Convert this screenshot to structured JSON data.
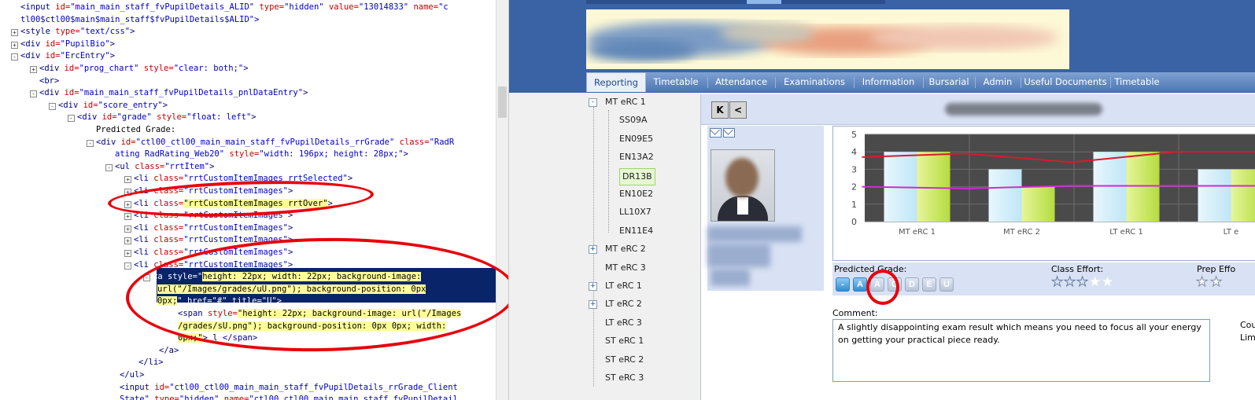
{
  "inspector": {
    "lines": [
      {
        "ind": 26,
        "exp": "",
        "parts": [
          [
            "tg",
            "<input "
          ],
          [
            "at",
            "id="
          ],
          [
            "av",
            "\"main_main_staff_fvPupilDetails_ALID\" "
          ],
          [
            "at",
            "type="
          ],
          [
            "av",
            "\"hidden\" "
          ],
          [
            "at",
            "value="
          ],
          [
            "av",
            "\"13014833\" "
          ],
          [
            "at",
            "name="
          ],
          [
            "av",
            "\"c"
          ]
        ]
      },
      {
        "ind": 26,
        "exp": "",
        "parts": [
          [
            "av",
            "tl00$ctl00$main$main_staff$fvPupilDetails$ALID\""
          ],
          [
            "tg",
            ">"
          ]
        ]
      },
      {
        "ind": 26,
        "exp": "+",
        "parts": [
          [
            "tg",
            "<style "
          ],
          [
            "at",
            "type="
          ],
          [
            "av",
            "\"text/css\""
          ],
          [
            "tg",
            ">"
          ]
        ]
      },
      {
        "ind": 26,
        "exp": "+",
        "parts": [
          [
            "tg",
            "<div "
          ],
          [
            "at",
            "id="
          ],
          [
            "av",
            "\"PupilBio\""
          ],
          [
            "tg",
            ">"
          ]
        ]
      },
      {
        "ind": 26,
        "exp": "-",
        "parts": [
          [
            "tg",
            "<div "
          ],
          [
            "at",
            "id="
          ],
          [
            "av",
            "\"ErcEntry\""
          ],
          [
            "tg",
            ">"
          ]
        ]
      },
      {
        "ind": 50,
        "exp": "+",
        "parts": [
          [
            "tg",
            "<div "
          ],
          [
            "at",
            "id="
          ],
          [
            "av",
            "\"prog_chart\" "
          ],
          [
            "at",
            "style="
          ],
          [
            "av",
            "\"clear: both;\""
          ],
          [
            "tg",
            ">"
          ]
        ]
      },
      {
        "ind": 50,
        "exp": "",
        "parts": [
          [
            "tg",
            "<br>"
          ]
        ]
      },
      {
        "ind": 50,
        "exp": "-",
        "parts": [
          [
            "tg",
            "<div "
          ],
          [
            "at",
            "id="
          ],
          [
            "av",
            "\"main_main_staff_fvPupilDetails_pnlDataEntry\""
          ],
          [
            "tg",
            ">"
          ]
        ]
      },
      {
        "ind": 74,
        "exp": "-",
        "parts": [
          [
            "tg",
            "<div "
          ],
          [
            "at",
            "id="
          ],
          [
            "av",
            "\"score_entry\""
          ],
          [
            "tg",
            ">"
          ]
        ]
      },
      {
        "ind": 98,
        "exp": "-",
        "parts": [
          [
            "tg",
            "<div "
          ],
          [
            "at",
            "id="
          ],
          [
            "av",
            "\"grade\" "
          ],
          [
            "at",
            "style="
          ],
          [
            "av",
            "\"float: left\""
          ],
          [
            "tg",
            ">"
          ]
        ]
      },
      {
        "ind": 122,
        "exp": "",
        "parts": [
          [
            "tx",
            "Predicted Grade:"
          ]
        ]
      },
      {
        "ind": 122,
        "exp": "-",
        "parts": [
          [
            "tg",
            "<div "
          ],
          [
            "at",
            "id="
          ],
          [
            "av",
            "\"ctl00_ctl00_main_main_staff_fvPupilDetails_rrGrade\" "
          ],
          [
            "at",
            "class="
          ],
          [
            "av",
            "\"RadR"
          ]
        ]
      },
      {
        "ind": 146,
        "exp": "",
        "parts": [
          [
            "av",
            "ating RadRating_Web20\" "
          ],
          [
            "at",
            "style="
          ],
          [
            "av",
            "\"width: 196px; height: 28px;\""
          ],
          [
            "tg",
            ">"
          ]
        ]
      },
      {
        "ind": 146,
        "exp": "-",
        "parts": [
          [
            "tg",
            "<ul "
          ],
          [
            "at",
            "class="
          ],
          [
            "av",
            "\"rrtItem\""
          ],
          [
            "tg",
            ">"
          ]
        ]
      },
      {
        "ind": 170,
        "exp": "+",
        "parts": [
          [
            "tg",
            "<li "
          ],
          [
            "at",
            "class="
          ],
          [
            "av",
            "\"rrtCustomItemImages_rrtSelected\""
          ],
          [
            "tg",
            ">"
          ]
        ]
      },
      {
        "ind": 170,
        "exp": "+",
        "parts": [
          [
            "tg",
            "<li "
          ],
          [
            "at",
            "class="
          ],
          [
            "av",
            "\"rrtCustomItemImages\""
          ],
          [
            "tg",
            ">"
          ]
        ]
      },
      {
        "ind": 170,
        "exp": "+",
        "parts": [
          [
            "tg",
            "<li "
          ],
          [
            "at",
            "class="
          ],
          [
            "yl",
            "\"rrtCustomItemImages rrtOver\""
          ],
          [
            "tg",
            ">"
          ]
        ]
      },
      {
        "ind": 170,
        "exp": "+",
        "parts": [
          [
            "tg",
            "<li "
          ],
          [
            "at",
            "class="
          ],
          [
            "av",
            "\"rrtCustomItemImages\""
          ],
          [
            "tg",
            ">"
          ]
        ]
      },
      {
        "ind": 170,
        "exp": "+",
        "parts": [
          [
            "tg",
            "<li "
          ],
          [
            "at",
            "class="
          ],
          [
            "av",
            "\"rrtCustomItemImages\""
          ],
          [
            "tg",
            ">"
          ]
        ]
      },
      {
        "ind": 170,
        "exp": "+",
        "parts": [
          [
            "tg",
            "<li "
          ],
          [
            "at",
            "class="
          ],
          [
            "av",
            "\"rrtCustomItemImages\""
          ],
          [
            "tg",
            ">"
          ]
        ]
      },
      {
        "ind": 170,
        "exp": "+",
        "parts": [
          [
            "tg",
            "<li "
          ],
          [
            "at",
            "class="
          ],
          [
            "av",
            "\"rrtCustomItemImages\""
          ],
          [
            "tg",
            ">"
          ]
        ]
      },
      {
        "ind": 170,
        "exp": "-",
        "parts": [
          [
            "tg",
            "<li "
          ],
          [
            "at",
            "class="
          ],
          [
            "av",
            "\"rrtCustomItemImages\""
          ],
          [
            "tg",
            ">"
          ]
        ]
      },
      {
        "ind": 194,
        "exp": "-",
        "sel": true,
        "parts": [
          [
            "hl",
            "<a style=\""
          ],
          [
            "yl",
            "height: 22px; width: 22px; background-image:"
          ]
        ]
      },
      {
        "ind": 200,
        "exp": "",
        "sel": true,
        "parts": [
          [
            "yl",
            "url(\"/Images/grades/uU.png\"); background-position: 0px"
          ]
        ]
      },
      {
        "ind": 200,
        "exp": "",
        "sel": true,
        "parts": [
          [
            "yl",
            "0px;"
          ],
          [
            "hl",
            "\" href=\"#\" title=\"U\">"
          ]
        ]
      },
      {
        "ind": 226,
        "exp": "",
        "parts": [
          [
            "tg",
            "<span "
          ],
          [
            "at",
            "style="
          ],
          [
            "yl",
            "\"height: 22px; background-image: url(\"/Images"
          ]
        ]
      },
      {
        "ind": 226,
        "exp": "",
        "parts": [
          [
            "yl",
            "/grades/sU.png\"); background-position: 0px 0px; width:"
          ]
        ]
      },
      {
        "ind": 226,
        "exp": "",
        "parts": [
          [
            "yl",
            "0px;\""
          ],
          [
            "tg",
            ">"
          ],
          [
            "tx",
            " l "
          ],
          [
            "tg",
            "</span>"
          ]
        ]
      },
      {
        "ind": 202,
        "exp": "",
        "parts": [
          [
            "tg",
            "</a>"
          ]
        ]
      },
      {
        "ind": 176,
        "exp": "",
        "parts": [
          [
            "tg",
            "</li>"
          ]
        ]
      },
      {
        "ind": 152,
        "exp": "",
        "parts": [
          [
            "tg",
            "</ul>"
          ]
        ]
      },
      {
        "ind": 152,
        "exp": "",
        "parts": [
          [
            "tg",
            "<input "
          ],
          [
            "at",
            "id="
          ],
          [
            "av",
            "\"ctl00_ctl00_main_main_staff_fvPupilDetails_rrGrade_Client"
          ]
        ]
      },
      {
        "ind": 152,
        "exp": "",
        "parts": [
          [
            "av",
            "State\" "
          ],
          [
            "at",
            "type="
          ],
          [
            "av",
            "\"hidden\" "
          ],
          [
            "at",
            "name="
          ],
          [
            "av",
            "\"ctl00_ctl00_main_main_staff_fvPupilDetail"
          ]
        ]
      }
    ]
  },
  "app": {
    "main_nav": [
      {
        "label": "Reporting",
        "active": true
      },
      {
        "label": "Timetable"
      },
      {
        "label": "Attendance"
      },
      {
        "label": "Examinations"
      },
      {
        "label": "Information"
      },
      {
        "label": "Bursarial"
      },
      {
        "label": "Admin"
      },
      {
        "label": "Useful Documents"
      },
      {
        "label": "Timetable"
      }
    ],
    "tree": [
      {
        "label": "MT eRC 1",
        "level": 0,
        "exp": "-"
      },
      {
        "label": "SS09A",
        "level": 1
      },
      {
        "label": "EN09E5",
        "level": 1
      },
      {
        "label": "EN13A2",
        "level": 1
      },
      {
        "label": "DR13B",
        "level": 1,
        "selected": true
      },
      {
        "label": "EN10E2",
        "level": 1
      },
      {
        "label": "LL10X7",
        "level": 1
      },
      {
        "label": "EN11E4",
        "level": 1
      },
      {
        "label": "MT eRC 2",
        "level": 0,
        "exp": "+"
      },
      {
        "label": "MT eRC 3",
        "level": 0
      },
      {
        "label": "LT eRC 1",
        "level": 0,
        "exp": "+"
      },
      {
        "label": "LT eRC 2",
        "level": 0,
        "exp": "+"
      },
      {
        "label": "LT eRC 3",
        "level": 0
      },
      {
        "label": "ST eRC 1",
        "level": 0
      },
      {
        "label": "ST eRC 2",
        "level": 0
      },
      {
        "label": "ST eRC 3",
        "level": 0
      }
    ],
    "pager": {
      "first_label": "K",
      "prev_label": "<"
    },
    "grades": {
      "label": "Predicted Grade:",
      "buttons": [
        "-",
        "A",
        "A",
        "C",
        "D",
        "E",
        "U"
      ],
      "selected_index": 1
    },
    "class_effort": {
      "label": "Class Effort:",
      "stars_filled": 3,
      "stars_total": 5
    },
    "prep_effort": {
      "label": "Prep Effo"
    },
    "comment": {
      "label": "Comment:",
      "text": "A slightly disappointing exam result which means you need to focus all your energy on getting your practical piece ready."
    },
    "right_cutoff": [
      "Cou",
      "Lim"
    ],
    "colors": {
      "header": "#3a63a6",
      "accent": "#1f4b8e",
      "annotation": "#e8000b",
      "bar_blue": "#bfe6f7",
      "bar_green": "#b5dc3e",
      "line_red": "#d81b2b",
      "line_magenta": "#d02ad8"
    }
  },
  "chart_data": {
    "type": "bar",
    "categories": [
      "MT eRC 1",
      "MT eRC 2",
      "LT eRC 1",
      "LT e"
    ],
    "series": [
      {
        "values": [
          4,
          3,
          4,
          3
        ]
      },
      {
        "values": [
          4,
          2,
          4,
          3
        ]
      }
    ],
    "lines": [
      {
        "values": [
          3.7,
          3.9,
          3.4,
          4.0
        ]
      },
      {
        "values": [
          2.0,
          1.9,
          2.05,
          2.05
        ]
      }
    ],
    "yticks": [
      0,
      1,
      2,
      3,
      4,
      5
    ],
    "ylim": [
      0,
      5
    ],
    "grid": true
  }
}
